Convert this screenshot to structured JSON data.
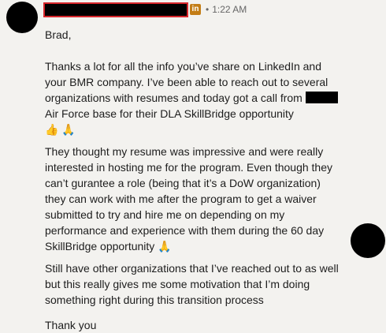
{
  "header": {
    "badge": "in",
    "separator": "•",
    "timestamp": "1:22 AM"
  },
  "message": {
    "greeting": "Brad,",
    "p1_text": "Thanks a lot for all the info you’ve share on LinkedIn and your BMR company. I’ve been able to reach out to several organizations with resumes and today got a call from",
    "p1_text2": "Air Force base for their DLA SkillBridge opportunity",
    "p2_text": "They thought my resume was impressive and were really interested in hosting me for the program. Even though they can’t gurantee a role (being that it’s a DoW organization) they can work with me after the program to get a waiver submitted to try and hire me on depending on my performance and experience with them during the 60 day SkillBridge opportunity",
    "p3_text": "Still have other organizations that I’ve reached out to as well but this really gives me some motivation that I’m doing something right during this transition process",
    "closing": "Thank you"
  },
  "icons": {
    "thumbs_up": "👍",
    "praying_hands": "🙏"
  }
}
